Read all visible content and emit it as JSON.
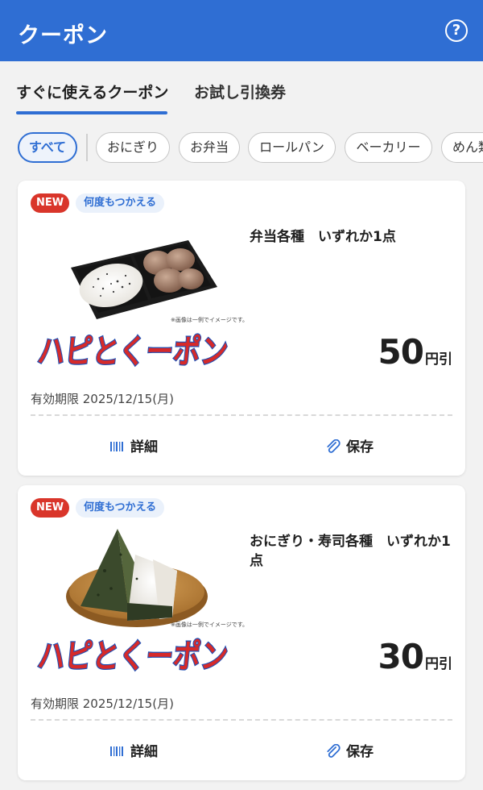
{
  "appbar": {
    "title": "クーポン",
    "help_icon": "help-circle-icon",
    "help_label": "?"
  },
  "tabs": [
    {
      "label": "すぐに使えるクーポン",
      "active": true
    },
    {
      "label": "お試し引換券",
      "active": false
    }
  ],
  "filters": [
    {
      "label": "すべて",
      "active": true
    },
    {
      "label": "おにぎり"
    },
    {
      "label": "お弁当"
    },
    {
      "label": "ロールパン"
    },
    {
      "label": "ベーカリー"
    },
    {
      "label": "めん類"
    }
  ],
  "coupons": [
    {
      "badge_new": "NEW",
      "badge_reuse": "何度もつかえる",
      "image_note": "※画像は一例でイメージです。",
      "logo_text": "ハピとくーポン",
      "product": "弁当各種　いずれか1点",
      "price_value": "50",
      "price_unit": "円引",
      "expiry": "有効期限 2025/12/15(月)",
      "detail_label": "詳細",
      "save_label": "保存"
    },
    {
      "badge_new": "NEW",
      "badge_reuse": "何度もつかえる",
      "image_note": "※画像は一例でイメージです。",
      "logo_text": "ハピとくーポン",
      "product": "おにぎり・寿司各種　いずれか1点",
      "price_value": "30",
      "price_unit": "円引",
      "expiry": "有効期限 2025/12/15(月)",
      "detail_label": "詳細",
      "save_label": "保存"
    }
  ],
  "colors": {
    "primary": "#2f6ed3",
    "new_badge": "#d9352a",
    "logo_red": "#d62a2a",
    "logo_blue": "#1d4fb5"
  },
  "icons": {
    "detail": "barcode-icon",
    "save": "paperclip-icon"
  }
}
